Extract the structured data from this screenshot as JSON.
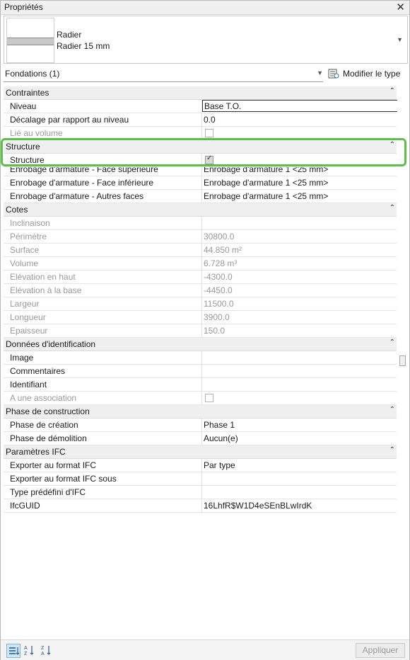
{
  "window": {
    "title": "Propriétés",
    "close_glyph": "✕"
  },
  "type_selector": {
    "family": "Radier",
    "type": "Radier 15 mm"
  },
  "filter": {
    "label": "Fondations (1)",
    "edit_type_label": "Modifier le type"
  },
  "collapse_glyph": "⌃",
  "groups": {
    "contraintes": {
      "name": "Contraintes",
      "rows": [
        {
          "name": "Niveau",
          "value": "Base T.O."
        },
        {
          "name": "Décalage par rapport au niveau",
          "value": "0.0"
        },
        {
          "name": "Lié au volume",
          "value": ""
        }
      ]
    },
    "structure": {
      "name": "Structure",
      "rows": [
        {
          "name": "Structure",
          "value": ""
        },
        {
          "name": "Enrobage d'armature - Face supérieure",
          "value": "Enrobage d'armature 1 <25 mm>"
        },
        {
          "name": "Enrobage d'armature - Face inférieure",
          "value": "Enrobage d'armature 1 <25 mm>"
        },
        {
          "name": "Enrobage d'armature - Autres faces",
          "value": "Enrobage d'armature 1 <25 mm>"
        }
      ]
    },
    "cotes": {
      "name": "Cotes",
      "rows": [
        {
          "name": "Inclinaison",
          "value": ""
        },
        {
          "name": "Périmètre",
          "value": "30800.0"
        },
        {
          "name": "Surface",
          "value": "44.850 m²"
        },
        {
          "name": "Volume",
          "value": "6.728 m³"
        },
        {
          "name": "Elévation en haut",
          "value": "-4300.0"
        },
        {
          "name": "Elévation à la base",
          "value": "-4450.0"
        },
        {
          "name": "Largeur",
          "value": "11500.0"
        },
        {
          "name": "Longueur",
          "value": "3900.0"
        },
        {
          "name": "Epaisseur",
          "value": "150.0"
        }
      ]
    },
    "identification": {
      "name": "Données d'identification",
      "rows": [
        {
          "name": "Image",
          "value": ""
        },
        {
          "name": "Commentaires",
          "value": ""
        },
        {
          "name": "Identifiant",
          "value": ""
        },
        {
          "name": "A une association",
          "value": ""
        }
      ]
    },
    "phase": {
      "name": "Phase de construction",
      "rows": [
        {
          "name": "Phase de création",
          "value": "Phase 1"
        },
        {
          "name": "Phase de démolition",
          "value": "Aucun(e)"
        }
      ]
    },
    "ifc": {
      "name": "Paramètres IFC",
      "rows": [
        {
          "name": "Exporter au format IFC",
          "value": "Par type"
        },
        {
          "name": "Exporter au format IFC sous",
          "value": ""
        },
        {
          "name": "Type prédéfini d'IFC",
          "value": ""
        },
        {
          "name": "IfcGUID",
          "value": "16LhfR$W1D4eSEnBLwIrdK"
        }
      ]
    }
  },
  "states": {
    "lie_au_volume_checked": false,
    "structure_checked": true,
    "association_checked": false
  },
  "bottom": {
    "apply_label": "Appliquer"
  },
  "colors": {
    "highlight": "#5dc049",
    "group_bg": "#efefef",
    "disabled_text": "#9a9a9a"
  },
  "icons": [
    "close-icon",
    "dropdown-arrow-icon",
    "edit-type-icon",
    "collapse-icon",
    "checkbox-icon",
    "categorized-view-icon",
    "sort-ascending-icon",
    "sort-descending-icon"
  ]
}
